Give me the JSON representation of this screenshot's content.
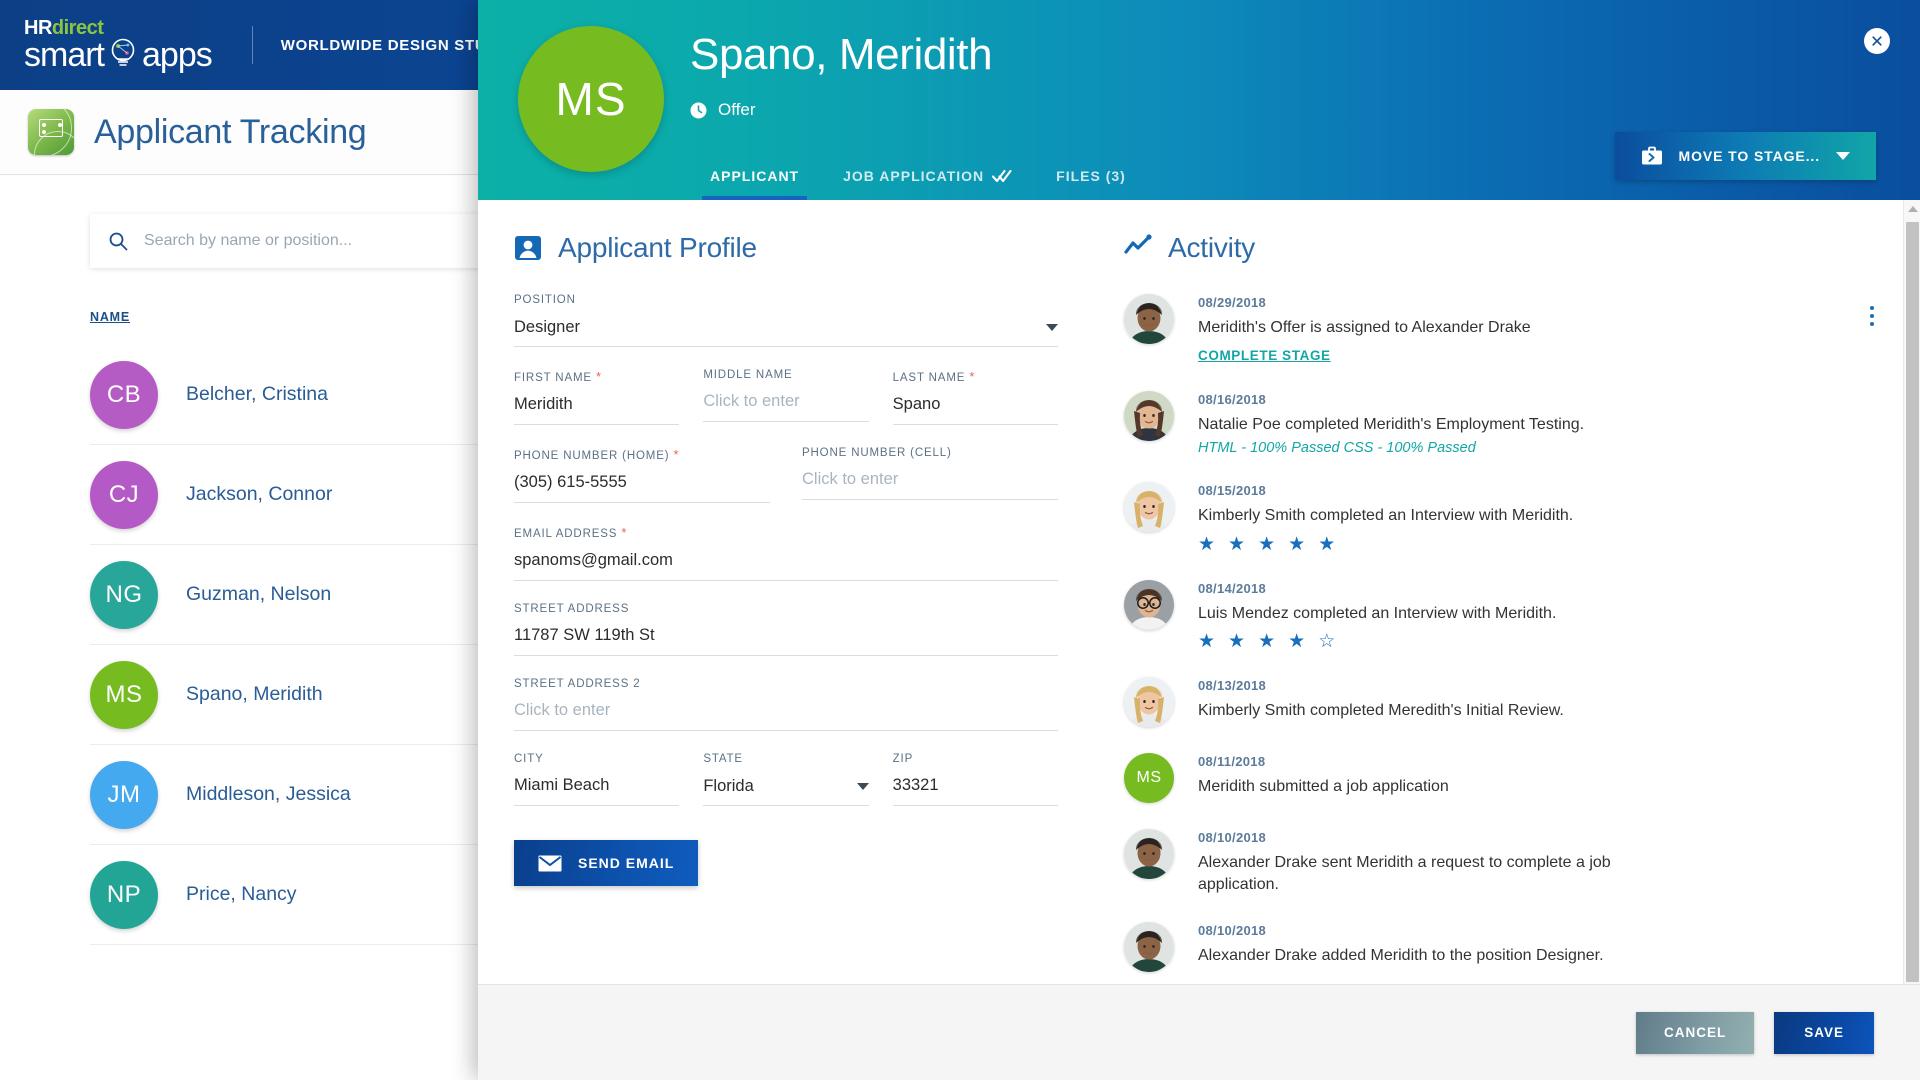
{
  "topbar": {
    "logo_primary": "HR",
    "logo_secondary": "direct",
    "logo_word_left": "smart",
    "logo_word_right": "apps",
    "company": "WORLDWIDE DESIGN STUDIOS"
  },
  "page": {
    "title": "Applicant Tracking",
    "app_icon": "applicant-tracking-icon"
  },
  "search": {
    "placeholder": "Search by name or position...",
    "value": "",
    "icon": "search-icon"
  },
  "list": {
    "column_header": "NAME",
    "items": [
      {
        "initials": "CB",
        "name": "Belcher, Cristina",
        "color": "#b55cc4"
      },
      {
        "initials": "CJ",
        "name": "Jackson, Connor",
        "color": "#b45ac6"
      },
      {
        "initials": "NG",
        "name": "Guzman, Nelson",
        "color": "#28a69a"
      },
      {
        "initials": "MS",
        "name": "Spano, Meridith",
        "color": "#76bc21"
      },
      {
        "initials": "JM",
        "name": "Middleson, Jessica",
        "color": "#44a9ee"
      },
      {
        "initials": "NP",
        "name": "Price, Nancy",
        "color": "#23a596"
      }
    ]
  },
  "modal": {
    "header": {
      "avatar_initials": "MS",
      "avatar_color": "#76bc21",
      "name": "Spano, Meridith",
      "stage_icon": "clock-icon",
      "stage_label": "Offer",
      "close_icon": "close-icon",
      "gradient_from": "#0cb0a6",
      "gradient_to": "#0a4e9e"
    },
    "tabs": [
      {
        "label": "APPLICANT",
        "active": true,
        "icon": ""
      },
      {
        "label": "JOB APPLICATION",
        "active": false,
        "icon": "double-check-icon"
      },
      {
        "label": "FILES (3)",
        "active": false,
        "icon": ""
      }
    ],
    "move_button": {
      "label": "MOVE TO STAGE...",
      "icon": "briefcase-arrow-icon",
      "caret": "chevron-down-icon"
    },
    "profile": {
      "section_icon": "user-card-icon",
      "section_title": "Applicant Profile",
      "fields": {
        "position": {
          "label": "POSITION",
          "value": "Designer",
          "type": "select",
          "required": false
        },
        "first_name": {
          "label": "FIRST NAME",
          "value": "Meridith",
          "required": true
        },
        "middle_name": {
          "label": "MIDDLE NAME",
          "value": "",
          "placeholder": "Click to enter",
          "required": false
        },
        "last_name": {
          "label": "LAST NAME",
          "value": "Spano",
          "required": true
        },
        "phone_home": {
          "label": "PHONE NUMBER (HOME)",
          "value": "(305) 615-5555",
          "required": true
        },
        "phone_cell": {
          "label": "PHONE NUMBER (CELL)",
          "value": "",
          "placeholder": "Click to enter",
          "required": false
        },
        "email": {
          "label": "EMAIL ADDRESS",
          "value": "spanoms@gmail.com",
          "required": true
        },
        "street1": {
          "label": "STREET ADDRESS",
          "value": "11787 SW 119th St",
          "required": false
        },
        "street2": {
          "label": "STREET ADDRESS 2",
          "value": "",
          "placeholder": "Click to enter",
          "required": false
        },
        "city": {
          "label": "CITY",
          "value": "Miami Beach",
          "required": false
        },
        "state": {
          "label": "STATE",
          "value": "Florida",
          "type": "select",
          "required": false
        },
        "zip": {
          "label": "ZIP",
          "value": "33321",
          "required": false
        }
      },
      "send_email_button": {
        "label": "SEND EMAIL",
        "icon": "envelope-icon"
      }
    },
    "activity": {
      "section_icon": "trend-line-icon",
      "section_title": "Activity",
      "items": [
        {
          "date": "08/29/2018",
          "text": "Meridith's Offer is assigned to Alexander Drake",
          "link": "COMPLETE STAGE",
          "avatar_type": "photo-male-dark",
          "has_menu": true
        },
        {
          "date": "08/16/2018",
          "text": "Natalie Poe completed Meridith's Employment Testing.",
          "subtext": "HTML - 100% Passed CSS - 100% Passed",
          "avatar_type": "photo-female-brunette",
          "has_menu": false
        },
        {
          "date": "08/15/2018",
          "text": "Kimberly Smith completed an Interview with Meridith.",
          "stars": 5,
          "stars_total": 5,
          "avatar_type": "photo-female-blonde",
          "has_menu": false
        },
        {
          "date": "08/14/2018",
          "text": "Luis Mendez completed an Interview with Meridith.",
          "stars": 4,
          "stars_total": 5,
          "avatar_type": "photo-male-glasses",
          "has_menu": false
        },
        {
          "date": "08/13/2018",
          "text": "Kimberly Smith completed Meredith's Initial Review.",
          "avatar_type": "photo-female-blonde",
          "has_menu": false
        },
        {
          "date": "08/11/2018",
          "text": "Meridith submitted a job application",
          "avatar_type": "initials",
          "avatar_initials": "MS",
          "avatar_color": "#76bc21",
          "has_menu": false
        },
        {
          "date": "08/10/2018",
          "text": "Alexander Drake sent Meridith a request to complete a job application.",
          "avatar_type": "photo-male-dark",
          "has_menu": false
        },
        {
          "date": "08/10/2018",
          "text": "Alexander Drake added Meridith to the position Designer.",
          "avatar_type": "photo-male-dark",
          "has_menu": false
        }
      ]
    },
    "footer": {
      "cancel_label": "CANCEL",
      "save_label": "SAVE"
    }
  }
}
